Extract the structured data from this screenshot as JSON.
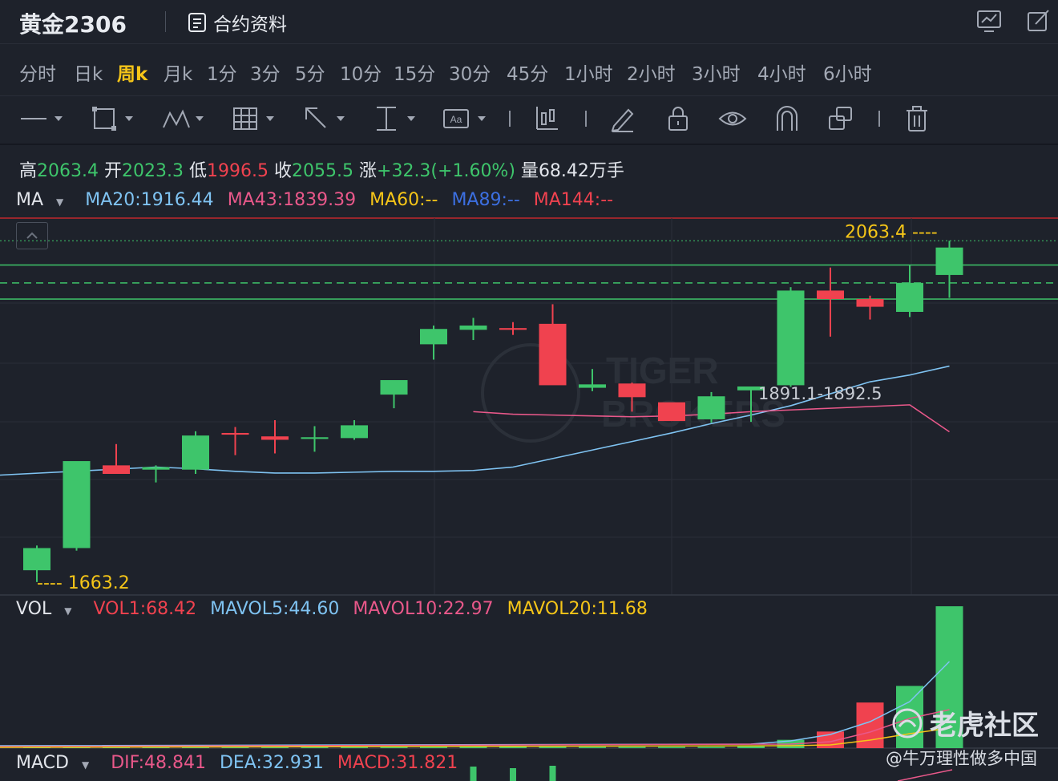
{
  "header": {
    "title": "黄金2306",
    "contract_label": "合约资料"
  },
  "periods": [
    "分时",
    "日k",
    "周k",
    "月k",
    "1分",
    "3分",
    "5分",
    "10分",
    "15分",
    "30分",
    "45分",
    "1小时",
    "2小时",
    "3小时",
    "4小时",
    "6小时"
  ],
  "active_period": "周k",
  "ohlc": {
    "high_label": "高",
    "high": "2063.4",
    "open_label": "开",
    "open": "2023.3",
    "low_label": "低",
    "low": "1996.5",
    "close_label": "收",
    "close": "2055.5",
    "change_label": "涨",
    "change": "+32.3(+1.60%)",
    "volume_label": "量",
    "volume": "68.42万手"
  },
  "ma": {
    "name": "MA",
    "ma20": "MA20:1916.44",
    "ma43": "MA43:1839.39",
    "ma60": "MA60:--",
    "ma89": "MA89:--",
    "ma144": "MA144:--"
  },
  "vol": {
    "name": "VOL",
    "vol1": "VOL1:68.42",
    "mavol5": "MAVOL5:44.60",
    "mavol10": "MAVOL10:22.97",
    "mavol20": "MAVOL20:11.68"
  },
  "macd": {
    "name": "MACD",
    "dif": "DIF:48.841",
    "dea": "DEA:32.931",
    "macd": "MACD:31.821"
  },
  "annotations": {
    "high_marker": "2063.4 ----",
    "low_marker": "---- 1663.2",
    "gap_label": "1891.1-1892.5"
  },
  "watermark": {
    "brand": "老虎社区",
    "credit": "@牛万理性做多中国",
    "bg_text_1": "TIGER",
    "bg_text_2": "BROKERS"
  },
  "colors": {
    "up": "#3ec56b",
    "down": "#f0424f",
    "ma20": "#7fc3f2",
    "ma43": "#e9588a",
    "ma60": "#f5c518",
    "ma89": "#3c6fe0",
    "ma144": "#f0424f",
    "accent": "#f5c518"
  },
  "chart_data": {
    "type": "candlestick",
    "candles": [
      {
        "o": 1677,
        "h": 1706,
        "l": 1663.2,
        "c": 1703
      },
      {
        "o": 1703,
        "h": 1802,
        "l": 1700,
        "c": 1805
      },
      {
        "o": 1800,
        "h": 1825,
        "l": 1795,
        "c": 1790
      },
      {
        "o": 1795,
        "h": 1800,
        "l": 1780,
        "c": 1798
      },
      {
        "o": 1795,
        "h": 1840,
        "l": 1790,
        "c": 1835
      },
      {
        "o": 1838,
        "h": 1845,
        "l": 1812,
        "c": 1836
      },
      {
        "o": 1834,
        "h": 1853,
        "l": 1814,
        "c": 1830
      },
      {
        "o": 1831,
        "h": 1846,
        "l": 1816,
        "c": 1833
      },
      {
        "o": 1832,
        "h": 1853,
        "l": 1830,
        "c": 1847
      },
      {
        "o": 1883,
        "h": 1888,
        "l": 1867,
        "c": 1900
      },
      {
        "o": 1942,
        "h": 1964,
        "l": 1924,
        "c": 1960
      },
      {
        "o": 1959,
        "h": 1973,
        "l": 1947,
        "c": 1964
      },
      {
        "o": 1961,
        "h": 1968,
        "l": 1953,
        "c": 1959
      },
      {
        "o": 1966,
        "h": 1989,
        "l": 1896,
        "c": 1894
      },
      {
        "o": 1891,
        "h": 1913,
        "l": 1887,
        "c": 1895
      },
      {
        "o": 1896,
        "h": 1897,
        "l": 1863,
        "c": 1880
      },
      {
        "o": 1874,
        "h": 1858,
        "l": 1852,
        "c": 1852
      },
      {
        "o": 1854,
        "h": 1886,
        "l": 1850,
        "c": 1881
      },
      {
        "o": 1888,
        "h": 1892,
        "l": 1851,
        "c": 1892.5
      },
      {
        "o": 1894,
        "h": 2009,
        "l": 1892,
        "c": 2005
      },
      {
        "o": 2005,
        "h": 2032,
        "l": 1951,
        "c": 1995
      },
      {
        "o": 1995,
        "h": 1999,
        "l": 1971,
        "c": 1986
      },
      {
        "o": 1980,
        "h": 2035,
        "l": 1974,
        "c": 2014
      },
      {
        "o": 2023.3,
        "h": 2063.4,
        "l": 1996.5,
        "c": 2055.5
      }
    ],
    "ma20": [
      1798,
      1796,
      1793,
      1791,
      1791,
      1792,
      1793,
      1793,
      1794,
      1798,
      1808,
      1818,
      1828,
      1838,
      1849,
      1859,
      1870,
      1884,
      1898,
      1906,
      1916.44
    ],
    "ma43": [
      1863,
      1860,
      1859,
      1858,
      1857,
      1858,
      1860,
      1863,
      1865,
      1867,
      1869,
      1871,
      1839.39
    ],
    "price_lines": [
      2035,
      2014,
      1995
    ],
    "volume": [
      0.5,
      0.6,
      0.6,
      0.6,
      0.6,
      0.6,
      0.6,
      0.6,
      0.6,
      0.6,
      0.6,
      0.6,
      0.6,
      0.6,
      0.6,
      0.6,
      0.6,
      0.6,
      1,
      4,
      8,
      22,
      30,
      68.42
    ],
    "volume_colors": [
      "up",
      "up",
      "up",
      "up",
      "up",
      "up",
      "up",
      "up",
      "up",
      "up",
      "up",
      "up",
      "up",
      "up",
      "up",
      "up",
      "up",
      "up",
      "up",
      "up",
      "down",
      "down",
      "up",
      "up"
    ]
  }
}
